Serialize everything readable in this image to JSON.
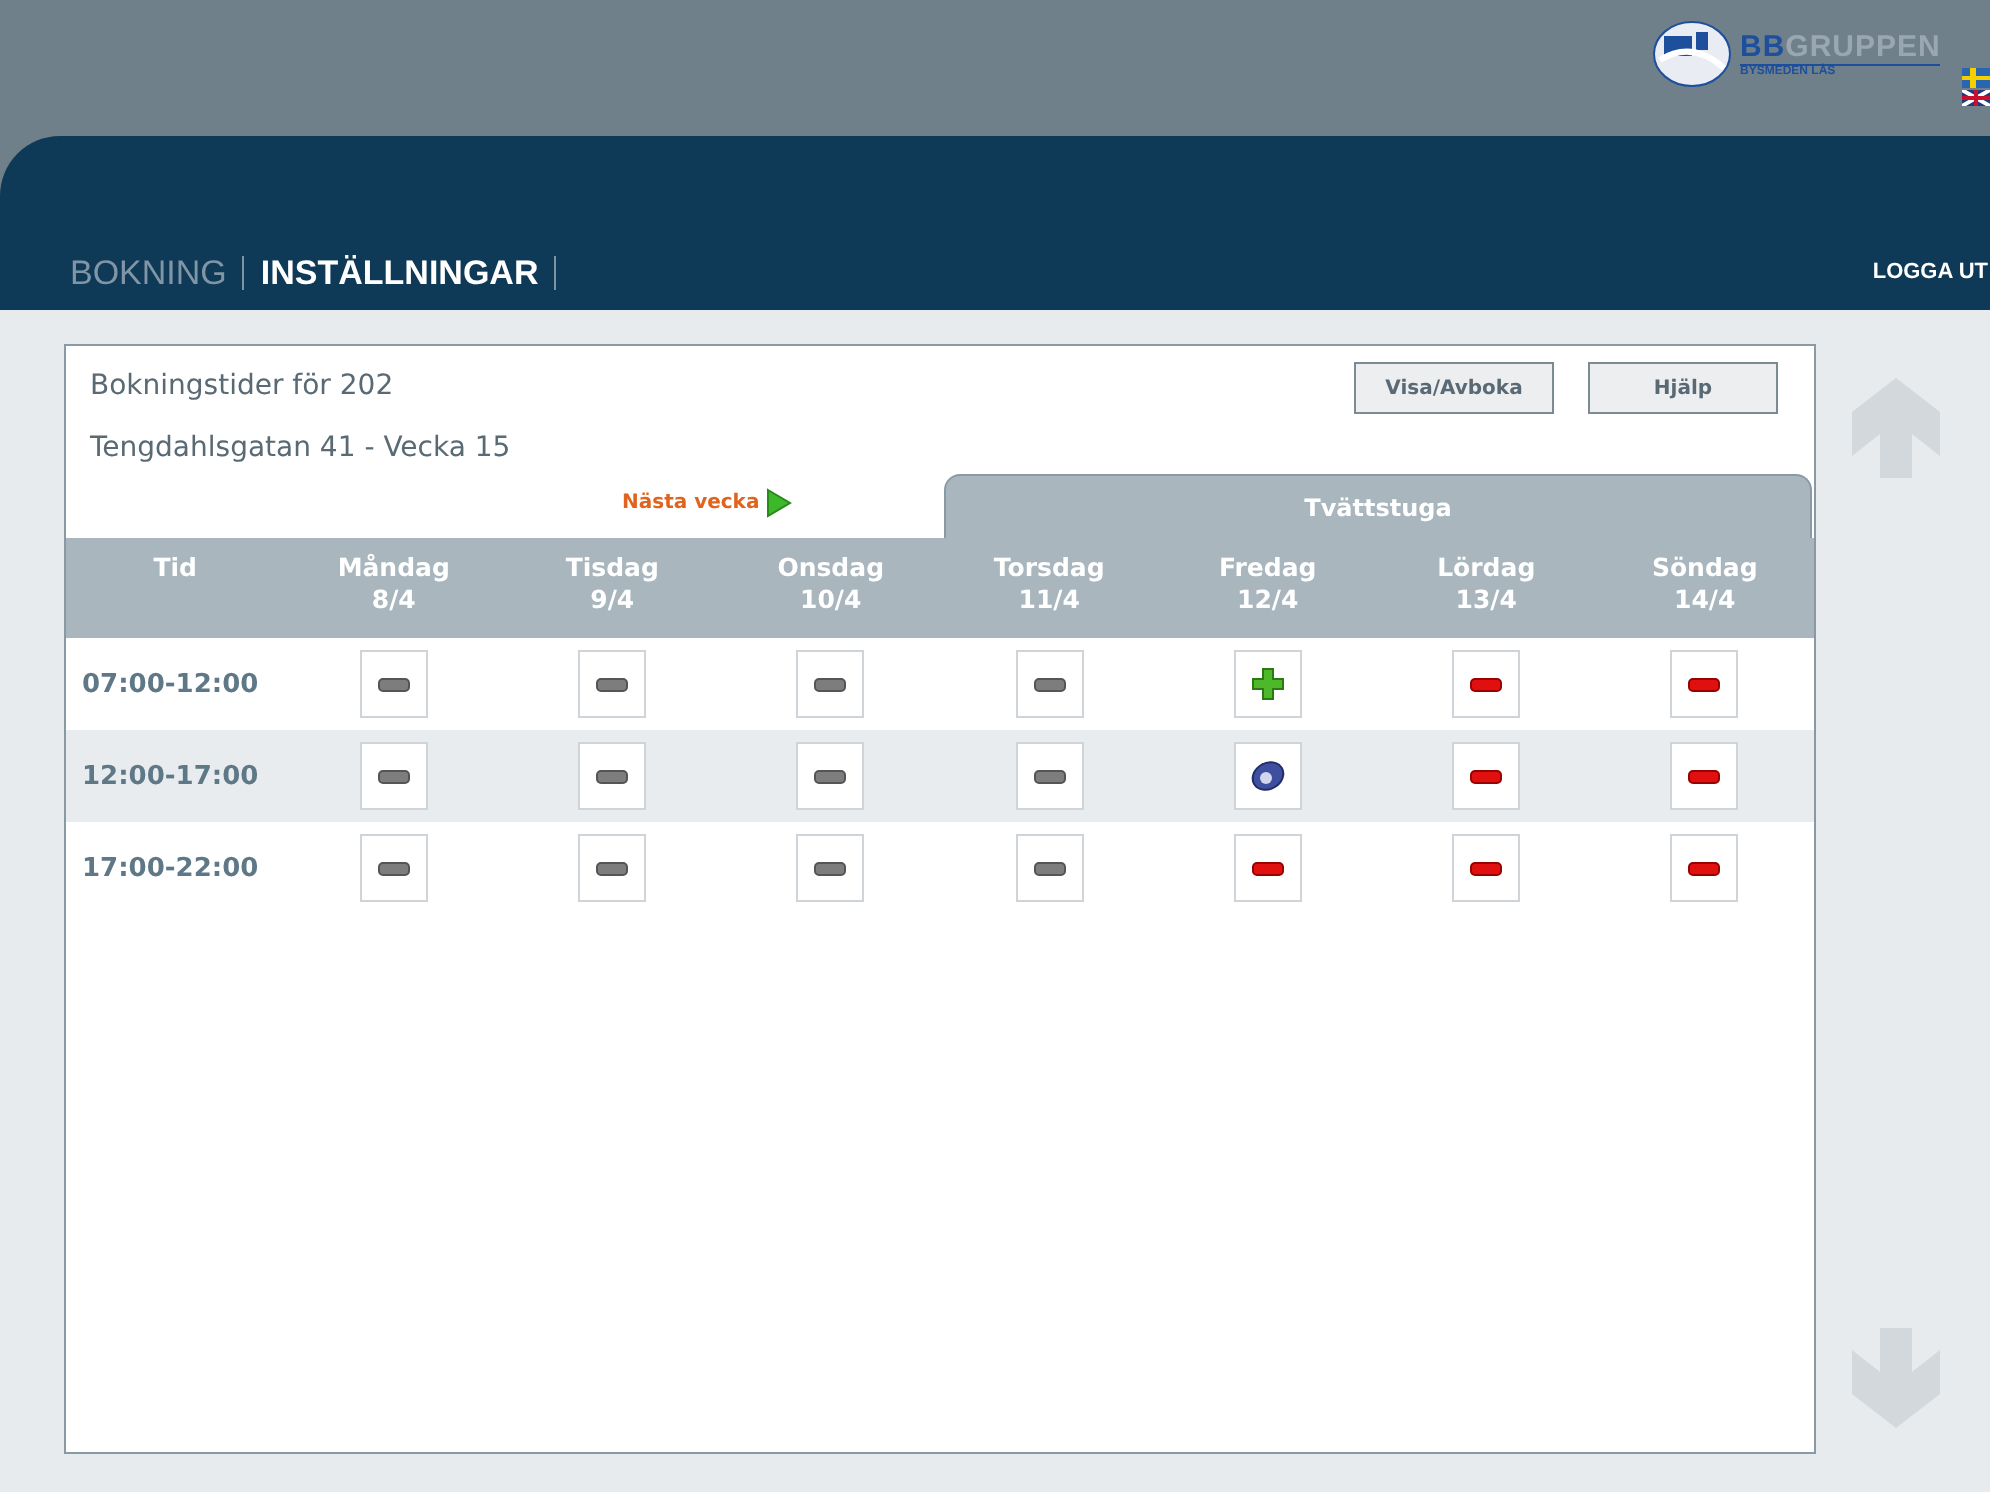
{
  "logo": {
    "brand_first": "BB",
    "brand_rest": "GRUPPEN",
    "tagline": "BYSMEDEN LÅS"
  },
  "nav": {
    "items": [
      {
        "label": "BOKNING",
        "selected": false
      },
      {
        "label": "INSTÄLLNINGAR",
        "selected": true
      }
    ],
    "logout": "LOGGA UT"
  },
  "panel": {
    "title": "Bokningstider för 202",
    "subtitle": "Tengdahlsgatan 41 - Vecka 15",
    "buttons": [
      "Visa/Avboka",
      "Hjälp"
    ],
    "next_week": "Nästa vecka",
    "tab": "Tvättstuga"
  },
  "table": {
    "columns": [
      {
        "day": "Tid"
      },
      {
        "day": "Måndag",
        "date": "8/4"
      },
      {
        "day": "Tisdag",
        "date": "9/4"
      },
      {
        "day": "Onsdag",
        "date": "10/4"
      },
      {
        "day": "Torsdag",
        "date": "11/4"
      },
      {
        "day": "Fredag",
        "date": "12/4"
      },
      {
        "day": "Lördag",
        "date": "13/4"
      },
      {
        "day": "Söndag",
        "date": "14/4"
      }
    ],
    "rows": [
      {
        "time": "07:00-12:00",
        "slots": [
          {
            "kind": "unavailable"
          },
          {
            "kind": "unavailable"
          },
          {
            "kind": "unavailable"
          },
          {
            "kind": "unavailable"
          },
          {
            "kind": "free"
          },
          {
            "kind": "booked"
          },
          {
            "kind": "booked"
          }
        ]
      },
      {
        "time": "12:00-17:00",
        "slots": [
          {
            "kind": "unavailable"
          },
          {
            "kind": "unavailable"
          },
          {
            "kind": "unavailable"
          },
          {
            "kind": "unavailable"
          },
          {
            "kind": "mine"
          },
          {
            "kind": "booked"
          },
          {
            "kind": "booked"
          }
        ]
      },
      {
        "time": "17:00-22:00",
        "slots": [
          {
            "kind": "unavailable"
          },
          {
            "kind": "unavailable"
          },
          {
            "kind": "unavailable"
          },
          {
            "kind": "unavailable"
          },
          {
            "kind": "booked"
          },
          {
            "kind": "booked"
          },
          {
            "kind": "booked"
          }
        ]
      }
    ]
  }
}
